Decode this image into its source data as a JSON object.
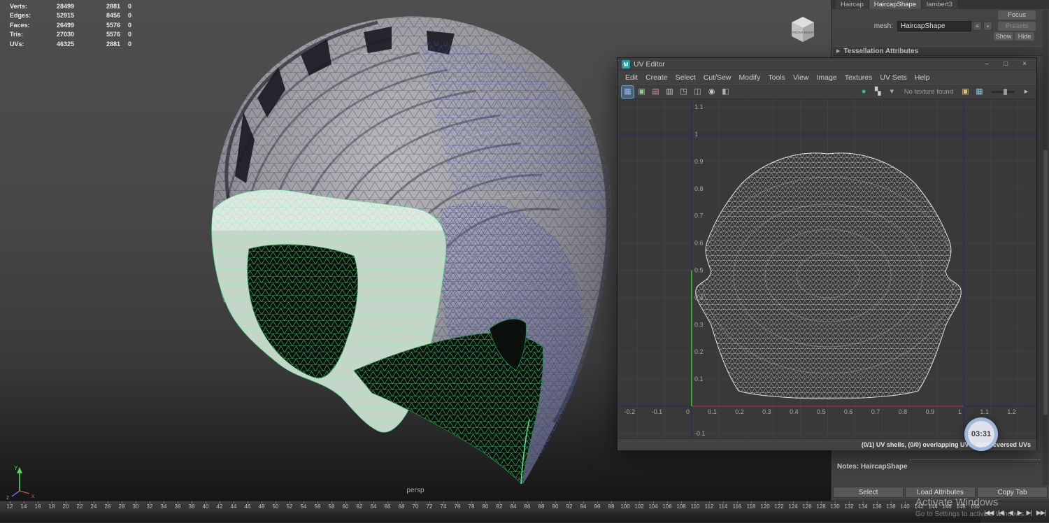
{
  "viewport": {
    "stats": {
      "rows": [
        {
          "label": "Verts:",
          "c1": "28499",
          "c2": "2881",
          "c3": "0"
        },
        {
          "label": "Edges:",
          "c1": "52915",
          "c2": "8456",
          "c3": "0"
        },
        {
          "label": "Faces:",
          "c1": "26499",
          "c2": "5576",
          "c3": "0"
        },
        {
          "label": "Tris:",
          "c1": "27030",
          "c2": "5576",
          "c3": "0"
        },
        {
          "label": "UVs:",
          "c1": "46325",
          "c2": "2881",
          "c3": "0"
        }
      ]
    },
    "camera_label": "persp",
    "view_cube": {
      "front": "FRONT",
      "right": "RIGHT"
    },
    "axis_gizmo": {
      "y": "Y",
      "z": "z",
      "x": "x"
    }
  },
  "uv_editor": {
    "title": "UV Editor",
    "icons": {
      "maya": "M",
      "minimize": "–",
      "maximize": "□",
      "close": "×"
    },
    "menus": [
      "Edit",
      "Create",
      "Select",
      "Cut/Sew",
      "Modify",
      "Tools",
      "View",
      "Image",
      "Textures",
      "UV Sets",
      "Help"
    ],
    "toolbar": {
      "left_icons": [
        {
          "name": "uv-shaded-display-icon",
          "glyph": "▦",
          "color": "#8fb7ff"
        },
        {
          "name": "image-display-icon",
          "glyph": "▣",
          "color": "#8fd08f"
        },
        {
          "name": "image-ratio-icon",
          "glyph": "▤",
          "color": "#d09090"
        },
        {
          "name": "grid-display-icon",
          "glyph": "▥",
          "color": "#c8c8c8"
        },
        {
          "name": "pixel-snap-icon",
          "glyph": "◳",
          "color": "#c8c8c8"
        },
        {
          "name": "shell-border-icon",
          "glyph": "◫",
          "color": "#64d8c8"
        },
        {
          "name": "texture-border-icon",
          "glyph": "◉",
          "color": "#c8c8c8"
        },
        {
          "name": "dim-image-icon",
          "glyph": "◧",
          "color": "#b0b0b0"
        }
      ],
      "right_icons": [
        {
          "name": "shader-ball-icon",
          "glyph": "●",
          "color": "#2fbfae"
        },
        {
          "name": "checker-map-icon",
          "glyph": "▚",
          "color": "#cfcfcf"
        },
        {
          "name": "chevron-down-icon",
          "glyph": "▾",
          "color": "#aaaaaa"
        }
      ],
      "texture_status": "No texture found",
      "post_icons": [
        {
          "name": "bake-texture-icon",
          "glyph": "▣",
          "color": "#d8c080"
        },
        {
          "name": "refresh-textures-icon",
          "glyph": "▦",
          "color": "#86c5d8"
        }
      ],
      "overflow_icon": {
        "name": "panel-arrow-icon",
        "glyph": "▸",
        "color": "#bbbbbb"
      }
    },
    "grid": {
      "x_tick_labels": [
        "-0.2",
        "-0.1",
        "0",
        "0.1",
        "0.2",
        "0.3",
        "0.4",
        "0.5",
        "0.6",
        "0.7",
        "0.8",
        "0.9",
        "1",
        "1.1",
        "1.2"
      ],
      "y_tick_labels": [
        "1.1",
        "1",
        "0.9",
        "0.8",
        "0.7",
        "0.6",
        "0.5",
        "0.4",
        "0.3",
        "0.2",
        "0.1",
        "-0.1"
      ]
    },
    "status": "(0/1) UV shells, (0/0) overlapping UVs, (0/0) reversed UVs"
  },
  "attribute_editor": {
    "tabs": [
      "Haircap",
      "HaircapShape",
      "lambert3"
    ],
    "mesh_field": {
      "label": "mesh:",
      "value": "HaircapShape"
    },
    "mini_buttons": [
      {
        "glyph": "≡"
      },
      {
        "glyph": "▪"
      }
    ],
    "focus_button": "Focus",
    "presets_button": "Presets",
    "show_button": "Show",
    "hide_button": "Hide",
    "sections": [
      {
        "arrow": "▶",
        "label": "Tessellation Attributes"
      }
    ],
    "notes_label": "Notes: HaircapShape",
    "footer_buttons": [
      "Select",
      "Load Attributes",
      "Copy Tab"
    ]
  },
  "timeline": {
    "start": 12,
    "end": 150,
    "step": 2,
    "controls": [
      {
        "name": "go-to-start-button",
        "glyph": "|◀◀"
      },
      {
        "name": "step-back-key-button",
        "glyph": "|◀"
      },
      {
        "name": "step-back-frame-button",
        "glyph": "◀"
      },
      {
        "name": "play-forward-button",
        "glyph": "▶"
      },
      {
        "name": "step-forward-frame-button",
        "glyph": "▶|"
      },
      {
        "name": "go-to-end-button",
        "glyph": "▶▶|"
      }
    ]
  },
  "overlays": {
    "clock": "03:31",
    "watermark": {
      "title": "Activate Windows",
      "subtitle": "Go to Settings to activate Windows."
    }
  },
  "colors": {
    "accent_green": "#35d07a",
    "wire_blue": "#4353c6",
    "axis_red": "#993333",
    "axis_green": "#33cc33",
    "uv_box_blue": "#2c2c5e"
  }
}
